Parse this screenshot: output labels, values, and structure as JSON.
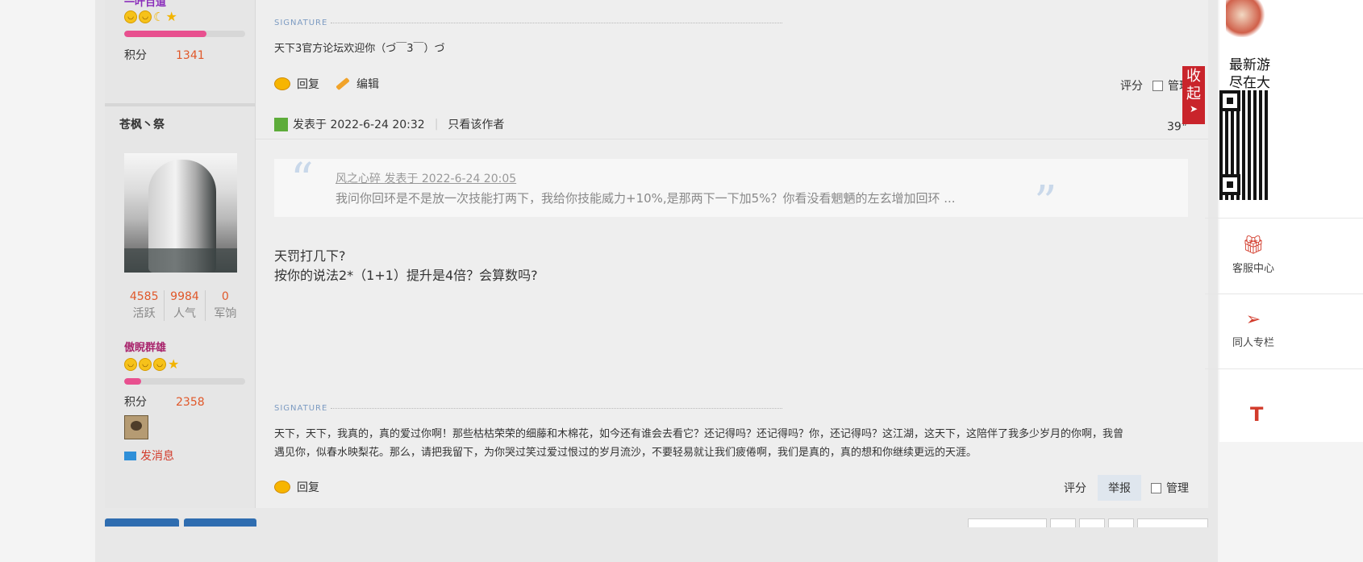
{
  "post1": {
    "rank_partial": "一叶百道",
    "score_label": "积分",
    "score_value": "1341",
    "signature_label": "SIGNATURE",
    "signature_text": "天下3官方论坛欢迎你（づ￣3￣）づ",
    "reply_label": "回复",
    "edit_label": "编辑",
    "rate_label": "评分",
    "manage_label": "管理"
  },
  "post2": {
    "username": "苍枫丶祭",
    "stats": [
      {
        "value": "4585",
        "label": "活跃"
      },
      {
        "value": "9984",
        "label": "人气"
      },
      {
        "value": "0",
        "label": "军饷"
      }
    ],
    "rank": "傲睨群雄",
    "score_label": "积分",
    "score_value": "2358",
    "pm_label": "发消息",
    "posted_label": "发表于 2022-6-24 20:32",
    "only_author_label": "只看该作者",
    "floor": "39",
    "floor_mark": "#",
    "quote_author": "风之心碎 发表于 2022-6-24 20:05",
    "quote_text": "我问你回环是不是放一次技能打两下，我给你技能威力+10%,是那两下一下加5%？你看没看魍魉的左玄增加回环 ...",
    "message_line1": "天罚打几下?",
    "message_line2": "按你的说法2*（1+1）提升是4倍？会算数吗?",
    "signature_label": "SIGNATURE",
    "signature_line1": "天下，天下，我真的，真的爱过你啊！那些枯枯荣荣的细藤和木棉花，如今还有谁会去看它？还记得吗？还记得吗？你，还记得吗？这江湖，这天下，这陪伴了我多少岁月的你啊，我曾",
    "signature_line2": "遇见你，似春水映梨花。那么，请把我留下，为你哭过笑过爱过恨过的岁月流沙，不要轻易就让我们疲倦啊，我们是真的，真的想和你继续更远的天涯。",
    "reply_label": "回复",
    "rate_label": "评分",
    "report_label": "举报",
    "manage_label": "管理",
    "level_fill": 0.14
  },
  "post1_level_fill": 0.68,
  "right_panel": {
    "collapse_label_1": "收",
    "collapse_label_2": "起",
    "collapse_arrow": "➤",
    "title1": "最新游",
    "title2": "尽在大",
    "service_label": "客服中心",
    "fan_label": "同人专栏",
    "bottom_text": "T"
  },
  "colors": {
    "accent_red": "#d23b2b",
    "score_orange": "#e0582a",
    "rank_purple": "#a8236b",
    "level_pink": "#e8508f"
  }
}
